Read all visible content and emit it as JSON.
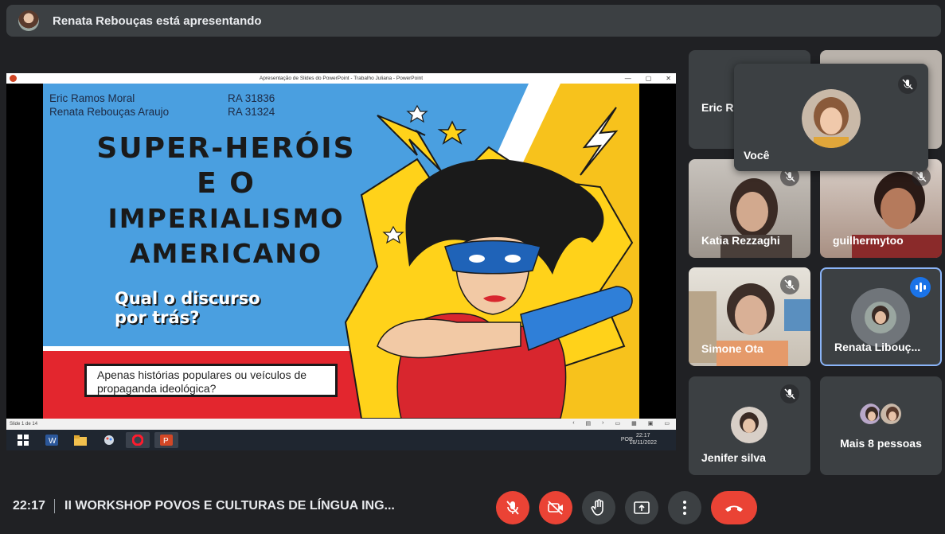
{
  "banner": {
    "text": "Renata Rebouças está apresentando"
  },
  "ppt_window": {
    "title": "Apresentação de Slides do PowerPoint - Trabalho Juliana - PowerPoint",
    "status": "Slide 1 de 14",
    "taskbar_lang": "POR",
    "taskbar_time": "22:17",
    "taskbar_date": "16/11/2022"
  },
  "slide": {
    "authors": [
      "Eric Ramos Moral",
      "Renata Rebouças Araujo"
    ],
    "ras": [
      "RA 31836",
      "RA 31324"
    ],
    "title_lines": [
      "SUPER-HERÓIS",
      "E O",
      "IMPERIALISMO",
      "AMERICANO"
    ],
    "question_lines": [
      "Qual o discurso",
      "por trás?"
    ],
    "box_text": "Apenas histórias populares ou veículos de propaganda ideológica?"
  },
  "participants": [
    {
      "name": "Eric R"
    },
    {
      "name": "Você"
    },
    {
      "name": "Katia Rezzaghi"
    },
    {
      "name": "guilhermytoo"
    },
    {
      "name": "Simone Ota"
    },
    {
      "name": "Renata Libouç..."
    },
    {
      "name": "Jenifer silva"
    },
    {
      "name": "Mais 8 pessoas"
    }
  ],
  "bottom": {
    "time": "22:17",
    "meeting_title": "II WORKSHOP POVOS E CULTURAS DE LÍNGUA ING..."
  },
  "colors": {
    "accent": "#8ab4f8",
    "danger": "#ea4335",
    "speaking": "#1a73e8"
  }
}
